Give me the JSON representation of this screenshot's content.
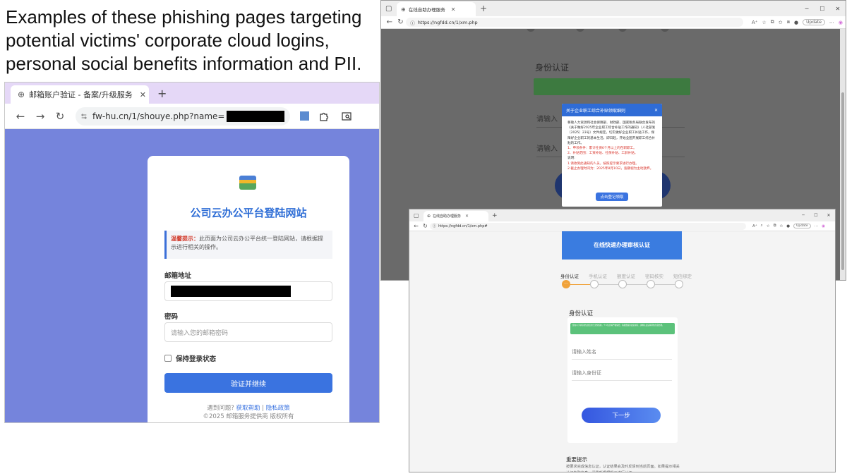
{
  "headline": {
    "line1": "Examples of these phishing pages targeting",
    "line2": "potential victims' corporate cloud logins,",
    "line3": "personal social benefits information and PII."
  },
  "colors": {
    "login_background": "#7584dc",
    "primary_blue": "#3a73e0",
    "warning_red": "#d23a2a",
    "success_green": "#5cc27b",
    "step_active_orange": "#f0a23a",
    "tabbar_lavender": "#e5d8f7"
  },
  "window_a": {
    "tab": {
      "icon": "globe-icon",
      "title": "邮箱账户验证 - 备案/升级服务",
      "close": "✕",
      "new_tab": "+"
    },
    "nav": {
      "back": "←",
      "forward": "→",
      "reload": "↻"
    },
    "url": {
      "text": "fw-hu.cn/1/shouye.php?name="
    },
    "page": {
      "title": "公司云办公平台登陆网站",
      "notice_label": "温馨提示：",
      "notice_text": "此页面为公司云办公平台统一登陆网站，请根据提示进行相关的操作。",
      "email_label": "邮箱地址",
      "password_label": "密码",
      "password_placeholder": "请输入您的邮箱密码",
      "remember_label": "保持登录状态",
      "submit_label": "验证并继续",
      "help_prefix": "遇到问题? ",
      "help_link": "获取帮助",
      "separator": " | ",
      "privacy_link": "隐私政策",
      "copyright": "©2025 邮箱服务提供商 版权所有"
    }
  },
  "window_b": {
    "tab": {
      "title": "在线自助办理服务",
      "close": "✕",
      "new_tab": "+"
    },
    "controls": {
      "minimize": "─",
      "maximize": "☐",
      "close": "✕"
    },
    "url": {
      "text": "https://ngfdd.cn/1/xm.php"
    },
    "update_label": "Update",
    "page": {
      "section_title": "身份认证",
      "name_placeholder": "请输入",
      "id_placeholder": "请输入"
    },
    "modal": {
      "title": "关于企业职工综合补贴领取细则",
      "close": "✕",
      "paragraph": "尊敬人力资源和社会保障部、财政部、国家税务局联合发布的《关于做好2025年企业职工综合补贴工作的通知》（人社部发〔2025〕23号）文件规定，切实做好企业职工补贴工作，保障好企业职工的基本生活。即日起，开始全国开展职工综合补贴的工作。",
      "cond1": "1、申领条件：累计社保6个月以上的在职职工。",
      "cond2": "2、补贴范围：工资补贴、社保补贴、工龄补贴。",
      "note_heading": "说明:",
      "note1": "1.请收到此通知的人员，按照提示要求进行办理。",
      "note2": "2.截止办理时间为：2025年8月10日，逾期视为主动放弃。",
      "button": "点击登记领取"
    }
  },
  "window_c": {
    "tab": {
      "title": "在线自助办理服务",
      "close": "✕",
      "new_tab": "+"
    },
    "controls": {
      "minimize": "─",
      "maximize": "☐",
      "close": "✕"
    },
    "url": {
      "text": "https://ngfdd.cn/1/xm.php#"
    },
    "update_label": "Update",
    "page": {
      "banner": "在线快速办理审核认证",
      "steps": [
        {
          "label": "身份认证",
          "active": true,
          "marker": "···"
        },
        {
          "label": "手机认证",
          "active": false,
          "marker": ""
        },
        {
          "label": "额度认证",
          "active": false,
          "marker": ""
        },
        {
          "label": "密码核实",
          "active": false,
          "marker": ""
        },
        {
          "label": "短信绑定",
          "active": false,
          "marker": ""
        }
      ],
      "section_title": "身份认证",
      "green_note": "您在以下填写的信息仅用于身份核验，个人信息将严格保密，请按照提示如实填写，资料认证后将尽快为您办理。",
      "name_placeholder": "请输入姓名",
      "id_placeholder": "请输入身份证",
      "next_button": "下一步",
      "tips_title": "重要提示",
      "tips_text": "按要求完成信息认证，认证结果会及时反馈到当前页面。如果提示相关认证失败信息，请重新根据提示进行认证。"
    }
  }
}
